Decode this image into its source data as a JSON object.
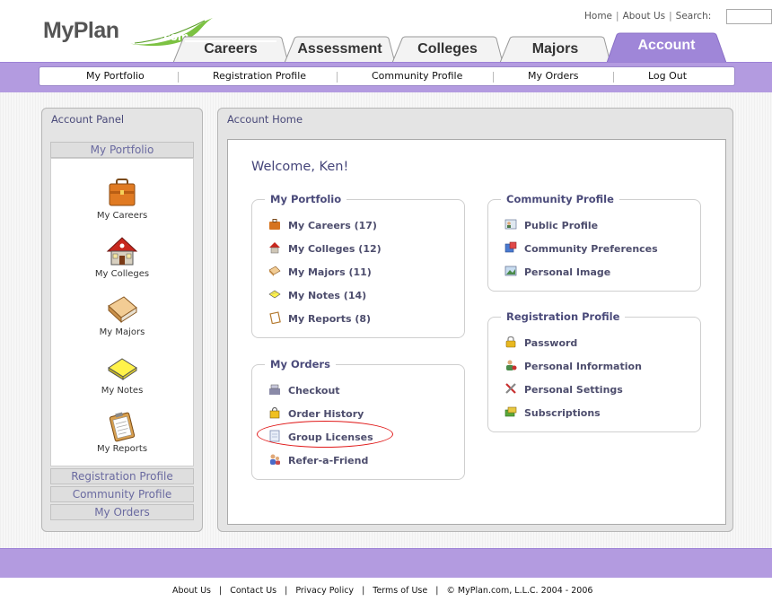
{
  "logo": {
    "text_main": "MyPlan",
    "text_leaf": ".com"
  },
  "toplinks": {
    "home": "Home",
    "about": "About Us",
    "search_label": "Search:",
    "search_value": ""
  },
  "tabs": [
    {
      "label": "Careers"
    },
    {
      "label": "Assessment"
    },
    {
      "label": "Colleges"
    },
    {
      "label": "Majors"
    },
    {
      "label": "Account"
    }
  ],
  "subnav": [
    "My Portfolio",
    "Registration Profile",
    "Community Profile",
    "My Orders",
    "Log Out"
  ],
  "left_panel": {
    "title": "Account Panel",
    "portfolio_header": "My Portfolio",
    "items": [
      {
        "label": "My Careers",
        "icon": "briefcase-icon"
      },
      {
        "label": "My Colleges",
        "icon": "schoolhouse-icon"
      },
      {
        "label": "My Majors",
        "icon": "book-icon"
      },
      {
        "label": "My Notes",
        "icon": "notepad-icon"
      },
      {
        "label": "My Reports",
        "icon": "clipboard-icon"
      }
    ],
    "footer_headers": [
      "Registration Profile",
      "Community Profile",
      "My Orders"
    ]
  },
  "right_panel": {
    "title": "Account Home",
    "welcome": "Welcome, Ken!",
    "my_portfolio": {
      "title": "My Portfolio",
      "items": [
        "My Careers (17)",
        "My Colleges (12)",
        "My Majors (11)",
        "My Notes (14)",
        "My Reports (8)"
      ]
    },
    "my_orders": {
      "title": "My Orders",
      "items": [
        "Checkout",
        "Order History",
        "Group Licenses",
        "Refer-a-Friend"
      ]
    },
    "community_profile": {
      "title": "Community Profile",
      "items": [
        "Public Profile",
        "Community Preferences",
        "Personal Image"
      ]
    },
    "registration_profile": {
      "title": "Registration Profile",
      "items": [
        "Password",
        "Personal Information",
        "Personal Settings",
        "Subscriptions"
      ]
    }
  },
  "footer": {
    "links": [
      "About Us",
      "Contact Us",
      "Privacy Policy",
      "Terms of Use"
    ],
    "copyright": "© MyPlan.com, L.L.C. 2004 - 2006"
  },
  "colors": {
    "accent_purple": "#b39be0",
    "tab_active": "#9f86d8",
    "highlight": "#e01818",
    "leaf_green": "#7cc242"
  }
}
